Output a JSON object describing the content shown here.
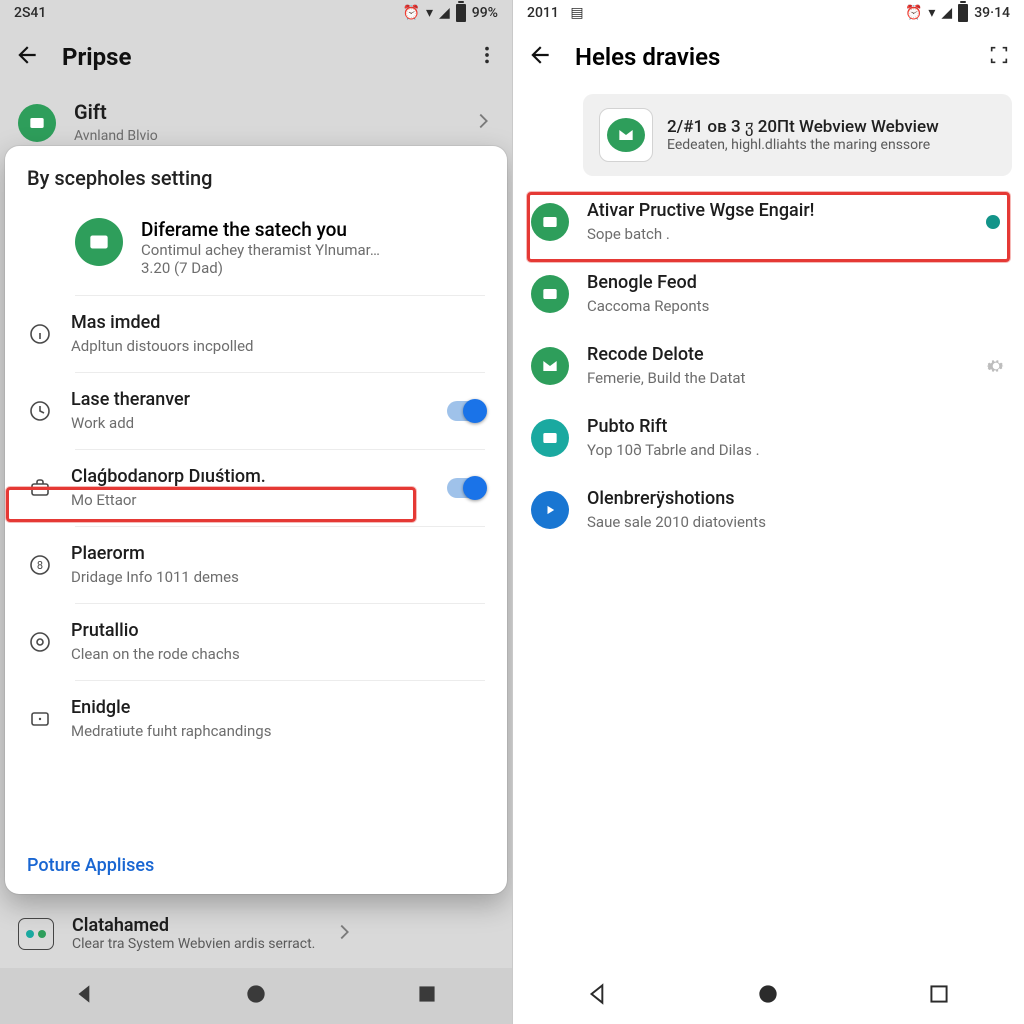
{
  "colors": {
    "accent_green": "#2e9e5b",
    "accent_teal": "#1aa9a0",
    "accent_blue": "#1976d2",
    "switch_on": "#1a73e8",
    "highlight": "#e53935",
    "link": "#1966d2"
  },
  "left": {
    "status": {
      "time": "2S41",
      "battery_pct": "99%"
    },
    "appbar": {
      "title": "Pripse"
    },
    "bg_item": {
      "title": "Gift",
      "subtitle": "Avnland Blvio"
    },
    "sheet": {
      "title": "By sсepholes setting",
      "hero": {
        "title": "Diferame the satech you",
        "line1": "Contimul achey theramist Ylnumar…",
        "line2": "3.20 (7 Dad)"
      },
      "rows": [
        {
          "id": "mas-imded",
          "icon": "info-icon",
          "title": "Mas imded",
          "subtitle": "Adpltun distouors incpolled",
          "toggle": false
        },
        {
          "id": "lase-ther",
          "icon": "clock-icon",
          "title": "Lase theranver",
          "subtitle": "Work add",
          "toggle": true
        },
        {
          "id": "clagbo",
          "icon": "suitcase-icon",
          "title": "Claǵbodanorp Dıuśtiom.",
          "subtitle": "Mo Ettaor",
          "toggle": true
        },
        {
          "id": "plaerorm",
          "icon": "eight-icon",
          "title": "Plaerorm",
          "subtitle": "Dridage Info 1011 demes",
          "toggle": false
        },
        {
          "id": "prutallio",
          "icon": "circle-o-icon",
          "title": "Prutallio",
          "subtitle": "Clean on the rode chachs",
          "toggle": false
        },
        {
          "id": "enidgle",
          "icon": "tablet-icon",
          "title": "Enidgle",
          "subtitle": "Medratiute fuıht raphcandings",
          "toggle": false
        }
      ],
      "action": "Poture Applises"
    },
    "bottom_item": {
      "title": "Clatahamed",
      "subtitle": "Clear tra System Webvien ardis serract."
    }
  },
  "right": {
    "status": {
      "time": "2011",
      "clock_right": "39·14"
    },
    "appbar": {
      "title": "Heles dravies"
    },
    "card": {
      "title": "2/#1 oв 3 ჳ 20Пt Webview Webview",
      "subtitle": "Eedeaten, highl.dliahts the maring enssore"
    },
    "list": [
      {
        "id": "ativar",
        "icon_class": "ic-green",
        "title": "Ativar Pructive Wgse Engair!",
        "subtitle": "Sope batch .",
        "trailing": "dot"
      },
      {
        "id": "benogle",
        "icon_class": "ic-green",
        "title": "Benogle Feod",
        "subtitle": "Caccoma Reponts",
        "trailing": null
      },
      {
        "id": "recode",
        "icon_class": "ic-green",
        "title": "Recode Delote",
        "subtitle": "Femerie, Build the Datat",
        "trailing": "gear"
      },
      {
        "id": "pubto",
        "icon_class": "ic-teal",
        "title": "Pubto Rift",
        "subtitle": "Yop 10∂ Tabrle and Dilas .",
        "trailing": null
      },
      {
        "id": "olen",
        "icon_class": "ic-blue",
        "title": "Olenbrerÿshotions",
        "subtitle": "Saue sale 2010 diatovients",
        "trailing": null
      }
    ]
  }
}
